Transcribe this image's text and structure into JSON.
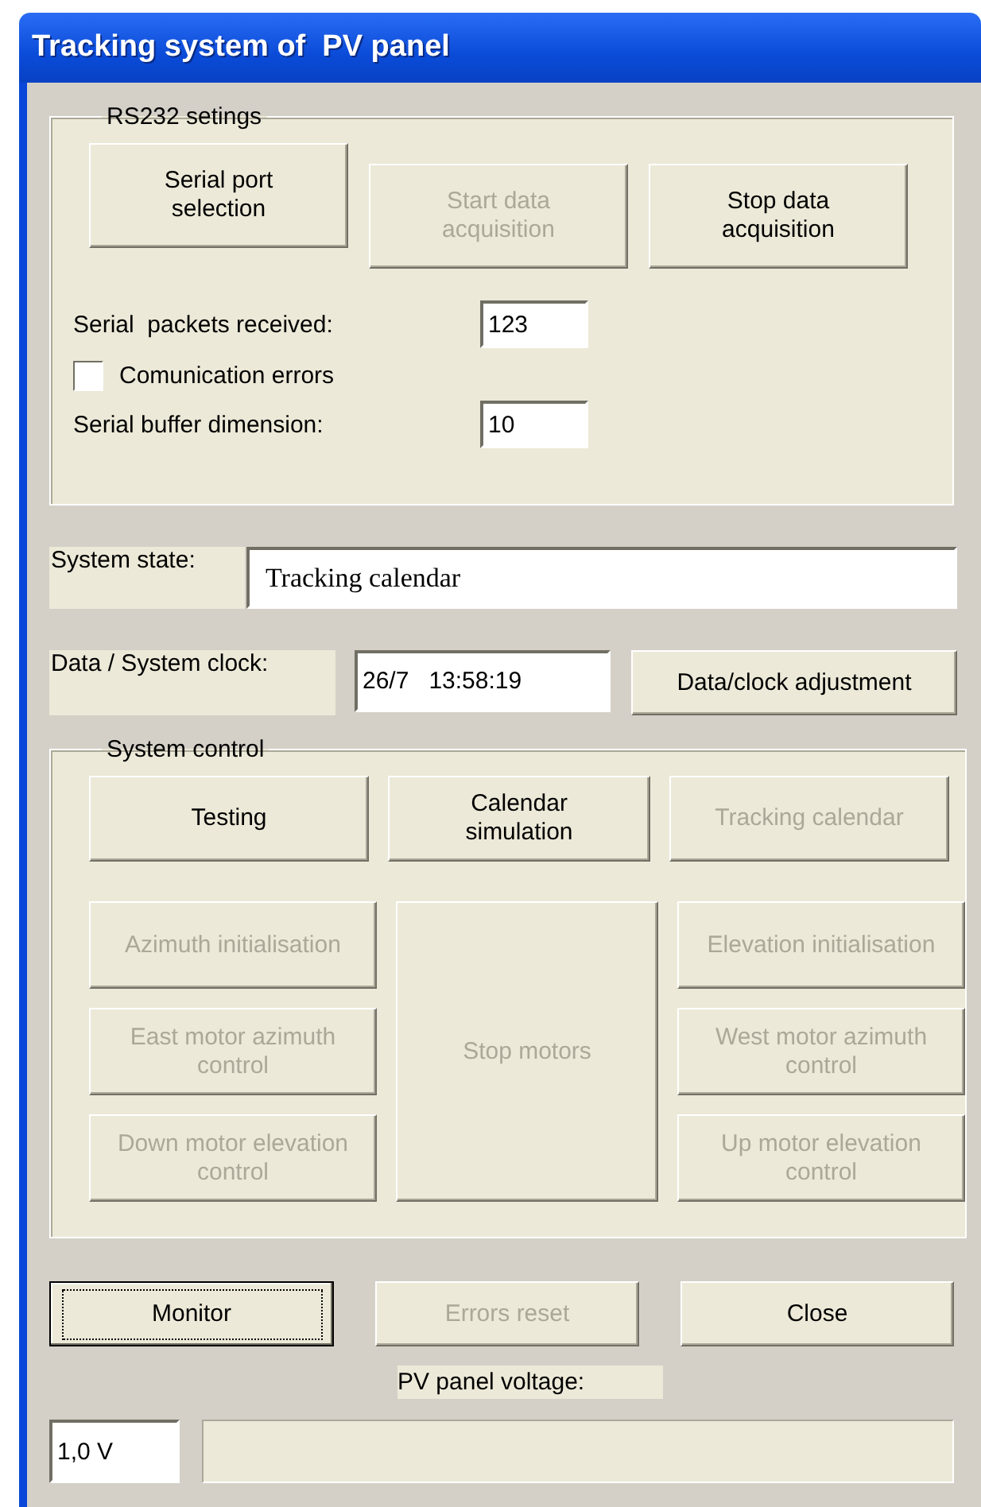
{
  "window": {
    "title": "Tracking system of  PV panel"
  },
  "rs232": {
    "legend": "RS232 setings",
    "buttons": [
      {
        "label": "Serial port selection",
        "disabled": false
      },
      {
        "label": "Start data acquisition",
        "disabled": true
      },
      {
        "label": "Stop data acquisition",
        "disabled": false
      }
    ],
    "packets_label": "Serial  packets received:",
    "packets_value": "123",
    "comm_errors": {
      "label": "Comunication errors",
      "checked": false
    },
    "buffer_label": "Serial buffer dimension:",
    "buffer_value": "10"
  },
  "system_state": {
    "label": "System state:",
    "value": "Tracking calendar"
  },
  "clock": {
    "label": "Data / System clock:",
    "value": "26/7   13:58:19",
    "button": {
      "label": "Data/clock adjustment",
      "disabled": false
    }
  },
  "system_control": {
    "legend": "System control",
    "top_row": [
      {
        "label": "Testing",
        "disabled": false
      },
      {
        "label": "Calendar simulation",
        "disabled": false
      },
      {
        "label": "Tracking calendar",
        "disabled": true
      }
    ],
    "left_column": [
      {
        "label": "Azimuth initialisation",
        "disabled": true
      },
      {
        "label": "East motor azimuth control",
        "disabled": true
      },
      {
        "label": "Down motor elevation control",
        "disabled": true
      }
    ],
    "center": {
      "label": "Stop motors",
      "disabled": true
    },
    "right_column": [
      {
        "label": "Elevation initialisation",
        "disabled": true
      },
      {
        "label": "West motor azimuth control",
        "disabled": true
      },
      {
        "label": "Up motor elevation control",
        "disabled": true
      }
    ]
  },
  "bottom_buttons": [
    {
      "label": "Monitor",
      "disabled": false,
      "focused": true
    },
    {
      "label": "Errors reset",
      "disabled": true,
      "focused": false
    },
    {
      "label": "Close",
      "disabled": false,
      "focused": false
    }
  ],
  "voltage": {
    "label": "PV panel voltage:",
    "value": "1,0 V",
    "level": 0
  }
}
